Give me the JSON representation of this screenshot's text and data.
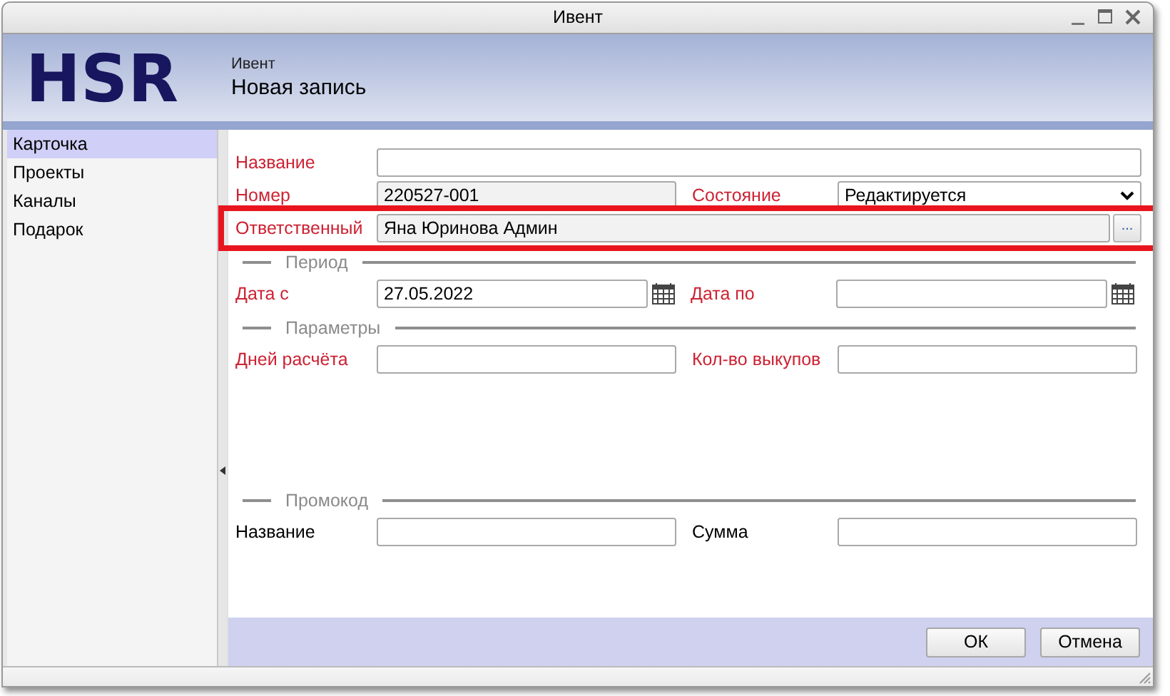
{
  "window": {
    "title": "Ивент"
  },
  "header": {
    "logo": "HSR",
    "subtitle": "Ивент",
    "title": "Новая запись"
  },
  "sidebar": {
    "items": [
      {
        "label": "Карточка",
        "selected": true
      },
      {
        "label": "Проекты",
        "selected": false
      },
      {
        "label": "Каналы",
        "selected": false
      },
      {
        "label": "Подарок",
        "selected": false
      }
    ]
  },
  "groups": [
    {
      "rows": [
        {
          "highlighted": false,
          "fields": [
            {
              "label": "Название",
              "required": true,
              "kind": "text",
              "readonly": false
            }
          ]
        },
        {
          "highlighted": false,
          "fields": [
            {
              "label": "Номер",
              "required": true,
              "kind": "text",
              "value": "220527-001",
              "readonly": true
            },
            {
              "label": "Состояние",
              "required": true,
              "kind": "select",
              "value": "Редактируется",
              "readonly": false
            }
          ]
        },
        {
          "highlighted": true,
          "fields": [
            {
              "label": "Ответственный",
              "required": true,
              "kind": "lookup",
              "value": "Яна Юринова Админ",
              "readonly": true,
              "button": "..."
            }
          ]
        }
      ]
    },
    {
      "title": "Период",
      "rows": [
        {
          "highlighted": false,
          "fields": [
            {
              "label": "Дата с",
              "required": true,
              "kind": "date",
              "value": "27.05.2022",
              "readonly": false
            },
            {
              "label": "Дата по",
              "required": true,
              "kind": "date",
              "readonly": false
            }
          ]
        }
      ]
    },
    {
      "title": "Параметры",
      "rows": [
        {
          "highlighted": false,
          "fields": [
            {
              "label": "Дней расчёта",
              "required": true,
              "kind": "text",
              "readonly": false
            },
            {
              "label": "Кол-во выкупов",
              "required": true,
              "kind": "text",
              "readonly": false
            }
          ]
        }
      ]
    },
    {
      "title": "Промокод",
      "rows": [
        {
          "highlighted": false,
          "fields": [
            {
              "label": "Название",
              "required": false,
              "kind": "text",
              "readonly": false
            },
            {
              "label": "Сумма",
              "required": false,
              "kind": "text",
              "readonly": false
            }
          ]
        }
      ]
    }
  ],
  "buttons": [
    "ОК",
    "Отмена"
  ]
}
